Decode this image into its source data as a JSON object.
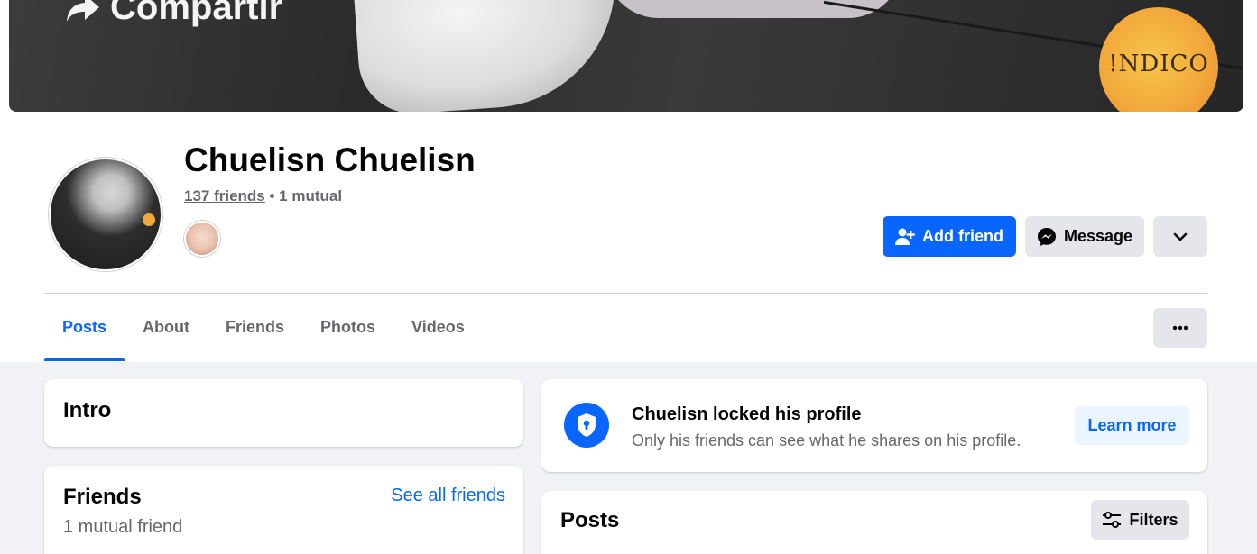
{
  "cover": {
    "overlay_text": "Compartir",
    "badge_text": "!NDICO"
  },
  "profile": {
    "name": "Chuelisn Chuelisn",
    "friends_count": "137 friends",
    "separator": " • ",
    "mutual": "1 mutual"
  },
  "actions": {
    "add_friend_label": "Add friend",
    "message_label": "Message"
  },
  "tabs": [
    {
      "label": "Posts",
      "active": true
    },
    {
      "label": "About",
      "active": false
    },
    {
      "label": "Friends",
      "active": false
    },
    {
      "label": "Photos",
      "active": false
    },
    {
      "label": "Videos",
      "active": false
    }
  ],
  "intro": {
    "title": "Intro"
  },
  "friends_section": {
    "title": "Friends",
    "see_all": "See all friends",
    "mutual_text": "1 mutual friend"
  },
  "locked": {
    "title": "Chuelisn locked his profile",
    "subtitle": "Only his friends can see what he shares on his profile.",
    "learn_more": "Learn more"
  },
  "posts": {
    "title": "Posts",
    "filters_label": "Filters"
  },
  "colors": {
    "primary": "#0866ff",
    "secondary_bg": "#e4e6eb",
    "page_bg": "#f0f2f5",
    "muted_text": "#65676b"
  },
  "icons": {
    "add_friend": "add-friend-icon",
    "message": "messenger-icon",
    "more": "chevron-down-icon",
    "tab_more": "more-dots-icon",
    "locked": "shield-lock-icon",
    "filters": "filters-icon"
  }
}
